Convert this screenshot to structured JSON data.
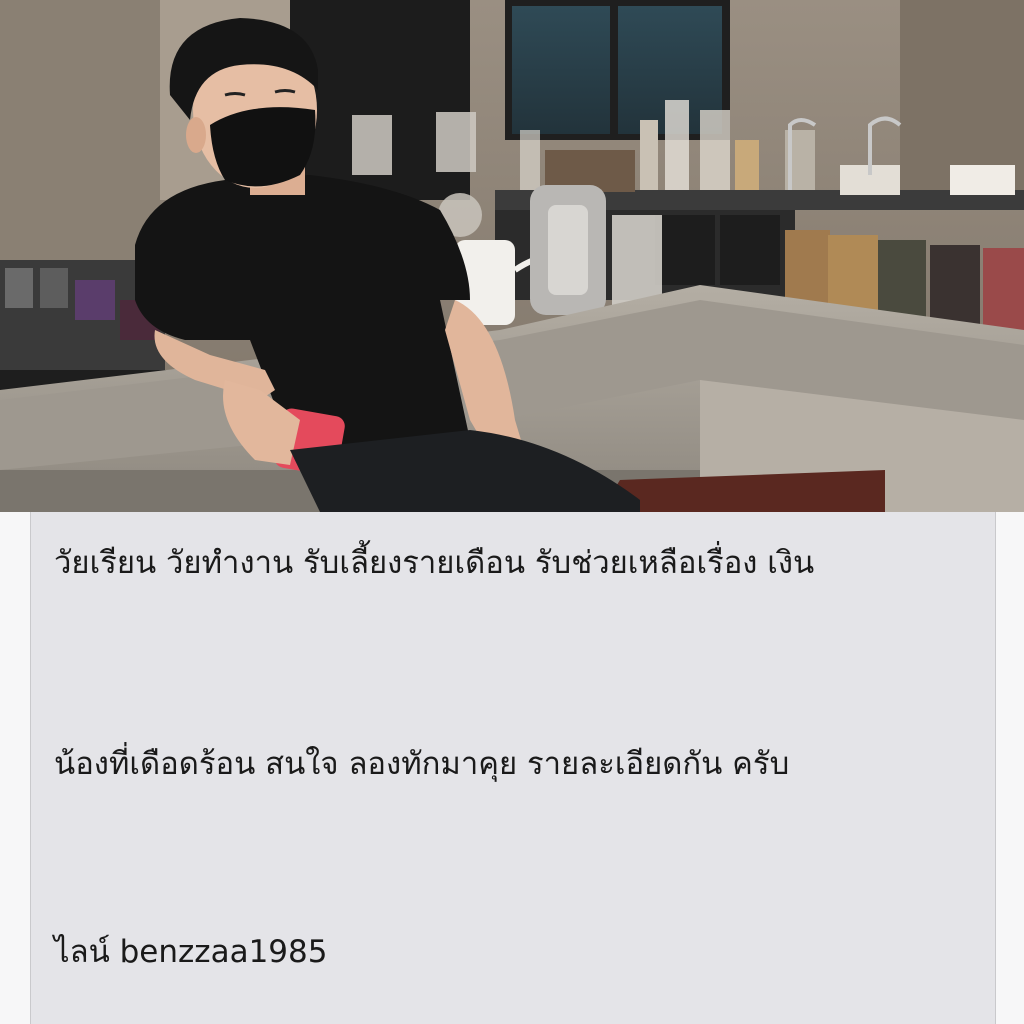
{
  "post": {
    "image": {
      "description_icon": "photo-image"
    },
    "caption": {
      "paragraph_1": "วัยเรียน วัยทำงาน รับเลี้ยงรายเดือน รับช่วยเหลือเรื่อง เงิน",
      "paragraph_2": "น้องที่เดือดร้อน สนใจ ลองทักมาคุย รายละเอียดกัน ครับ",
      "paragraph_3": "ไลน์ benzzaa1985"
    }
  }
}
